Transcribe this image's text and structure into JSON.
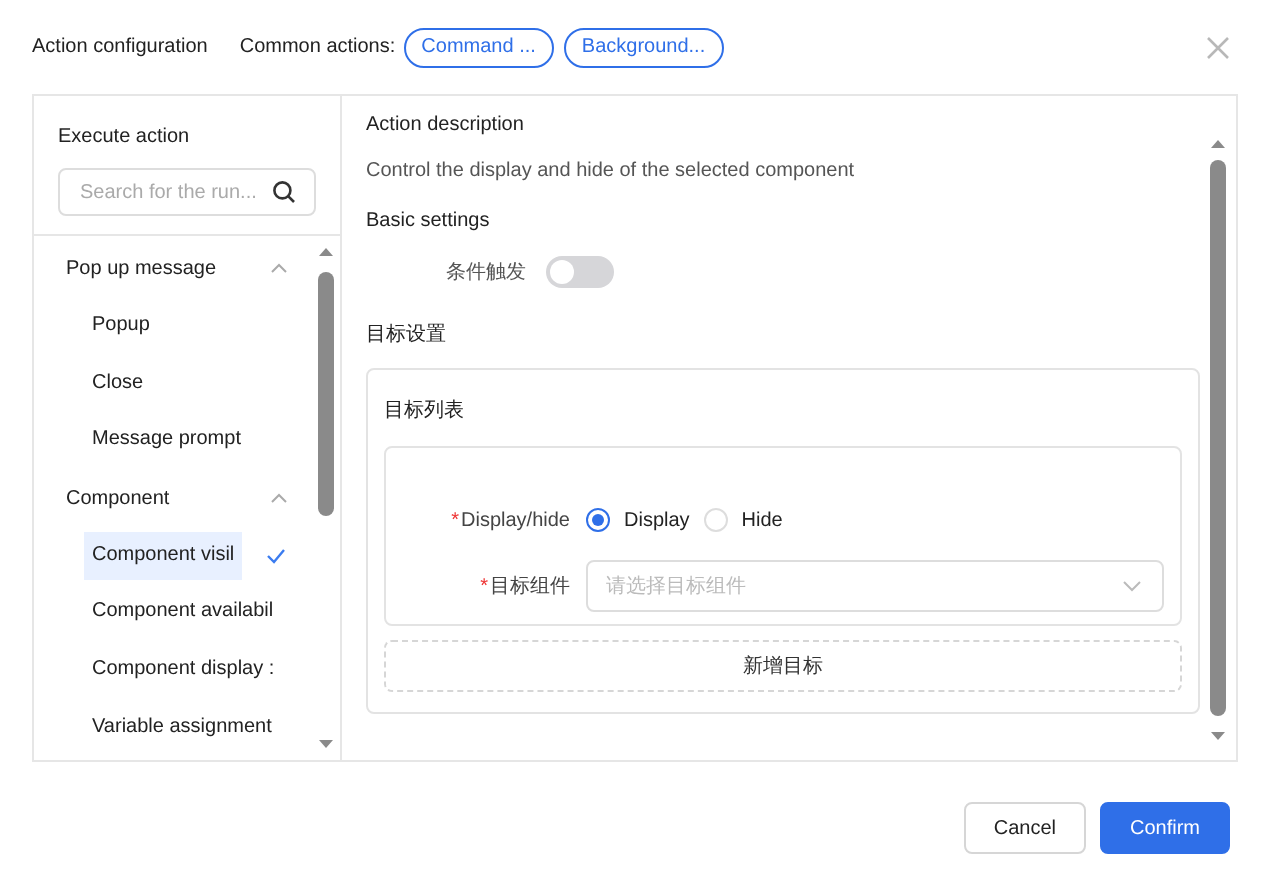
{
  "dialog": {
    "title": "Action configuration",
    "common_actions_label": "Common actions:",
    "common_actions": [
      "Command ...",
      "Background..."
    ]
  },
  "sidebar": {
    "title": "Execute action",
    "search": {
      "placeholder": "Search for the run..."
    },
    "groups": [
      {
        "label": "Pop up message",
        "expanded": true,
        "children": [
          {
            "label": "Popup",
            "selected": false
          },
          {
            "label": "Close",
            "selected": false
          },
          {
            "label": "Message prompt",
            "selected": false
          }
        ]
      },
      {
        "label": "Component",
        "expanded": true,
        "children": [
          {
            "label": "Component visil",
            "selected": true
          },
          {
            "label": "Component availabil",
            "selected": false
          },
          {
            "label": "Component display :",
            "selected": false
          },
          {
            "label": "Variable assignment",
            "selected": false
          }
        ]
      }
    ]
  },
  "content": {
    "description_title": "Action description",
    "description": "Control the display and hide of the selected component",
    "basic_settings": "Basic settings",
    "condition": {
      "label": "条件触发",
      "on": false
    },
    "target_settings": "目标设置",
    "target_list": {
      "title": "目标列表",
      "fields": [
        {
          "kind": "radio",
          "mark": "*",
          "label": "Display/hide",
          "options": [
            {
              "label": "Display",
              "selected": true
            },
            {
              "label": "Hide",
              "selected": false
            }
          ]
        },
        {
          "kind": "select",
          "mark": "*",
          "label": "目标组件",
          "placeholder": "请选择目标组件"
        }
      ],
      "add_button": "新增目标"
    }
  },
  "footer": {
    "buttons": [
      {
        "label": "Cancel",
        "kind": "secondary"
      },
      {
        "label": "Confirm",
        "kind": "primary"
      }
    ]
  }
}
